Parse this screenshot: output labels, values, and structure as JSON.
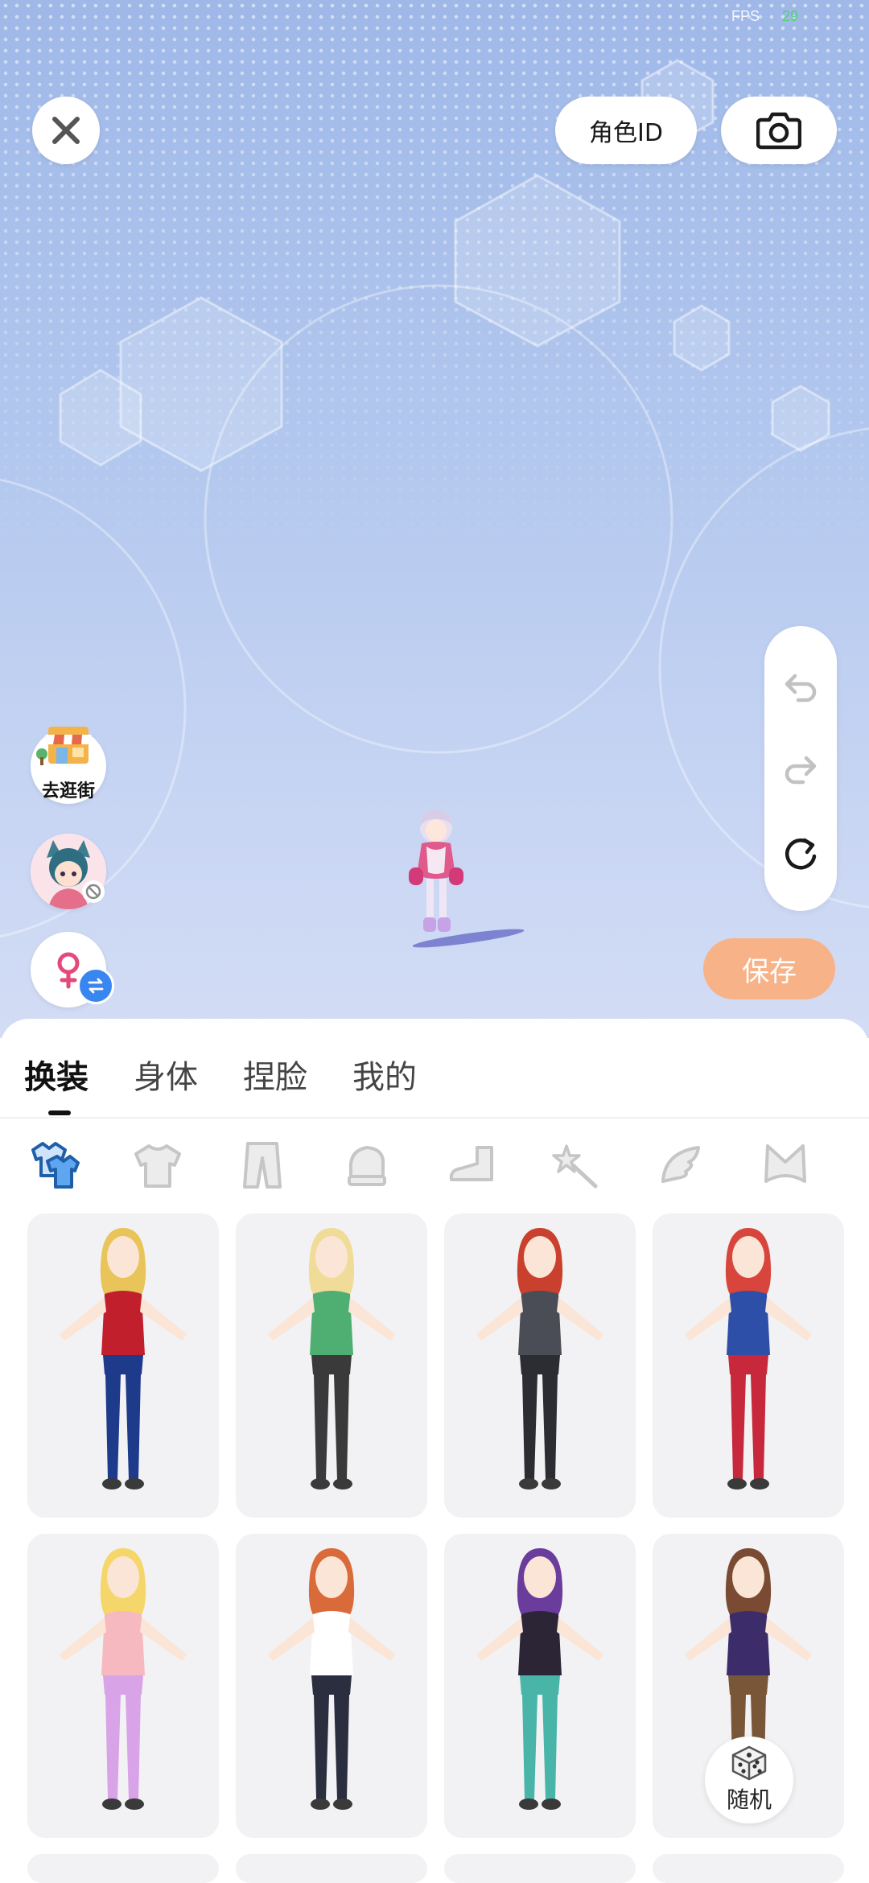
{
  "status": {
    "fps_label": "FPS",
    "fps_value": "29"
  },
  "top_bar": {
    "role_id_label": "角色ID",
    "close_icon": "close-icon",
    "camera_icon": "camera-icon"
  },
  "left_actions": {
    "shop_label": "去逛街",
    "gender": "female"
  },
  "history": {
    "undo_icon": "undo-icon",
    "redo_icon": "redo-icon",
    "reset_icon": "reset-icon"
  },
  "save_label": "保存",
  "tabs": [
    {
      "label": "换装",
      "active": true
    },
    {
      "label": "身体",
      "active": false
    },
    {
      "label": "捏脸",
      "active": false
    },
    {
      "label": "我的",
      "active": false
    }
  ],
  "categories": [
    "outfit-set-icon",
    "top-icon",
    "pants-icon",
    "gloves-icon",
    "shoes-icon",
    "wand-icon",
    "wing-icon",
    "ears-icon"
  ],
  "outfits": [
    {
      "name": "outfit-1",
      "colors": [
        "#c21f2c",
        "#1e3a8a",
        "#e8c45a"
      ]
    },
    {
      "name": "outfit-2",
      "colors": [
        "#4fae71",
        "#3a3a3a",
        "#f0dc98"
      ]
    },
    {
      "name": "outfit-3",
      "colors": [
        "#4a4d55",
        "#2b2d33",
        "#c9412e"
      ]
    },
    {
      "name": "outfit-4",
      "colors": [
        "#2d4fa8",
        "#c8283b",
        "#d8453c"
      ]
    },
    {
      "name": "outfit-5",
      "colors": [
        "#f6b9bf",
        "#d9a3e8",
        "#f5d66b"
      ]
    },
    {
      "name": "outfit-6",
      "colors": [
        "#ffffff",
        "#2a2e3f",
        "#d96a3a"
      ]
    },
    {
      "name": "outfit-7",
      "colors": [
        "#2b2535",
        "#49b4a8",
        "#6a3c9c"
      ]
    },
    {
      "name": "outfit-8",
      "colors": [
        "#3c2d6a",
        "#7a5638",
        "#7a4b32"
      ]
    }
  ],
  "random_label": "随机",
  "colors": {
    "save_bg": "#f8b287",
    "swap_badge": "#3a86f0",
    "scene_top": "#9fb8e8"
  }
}
